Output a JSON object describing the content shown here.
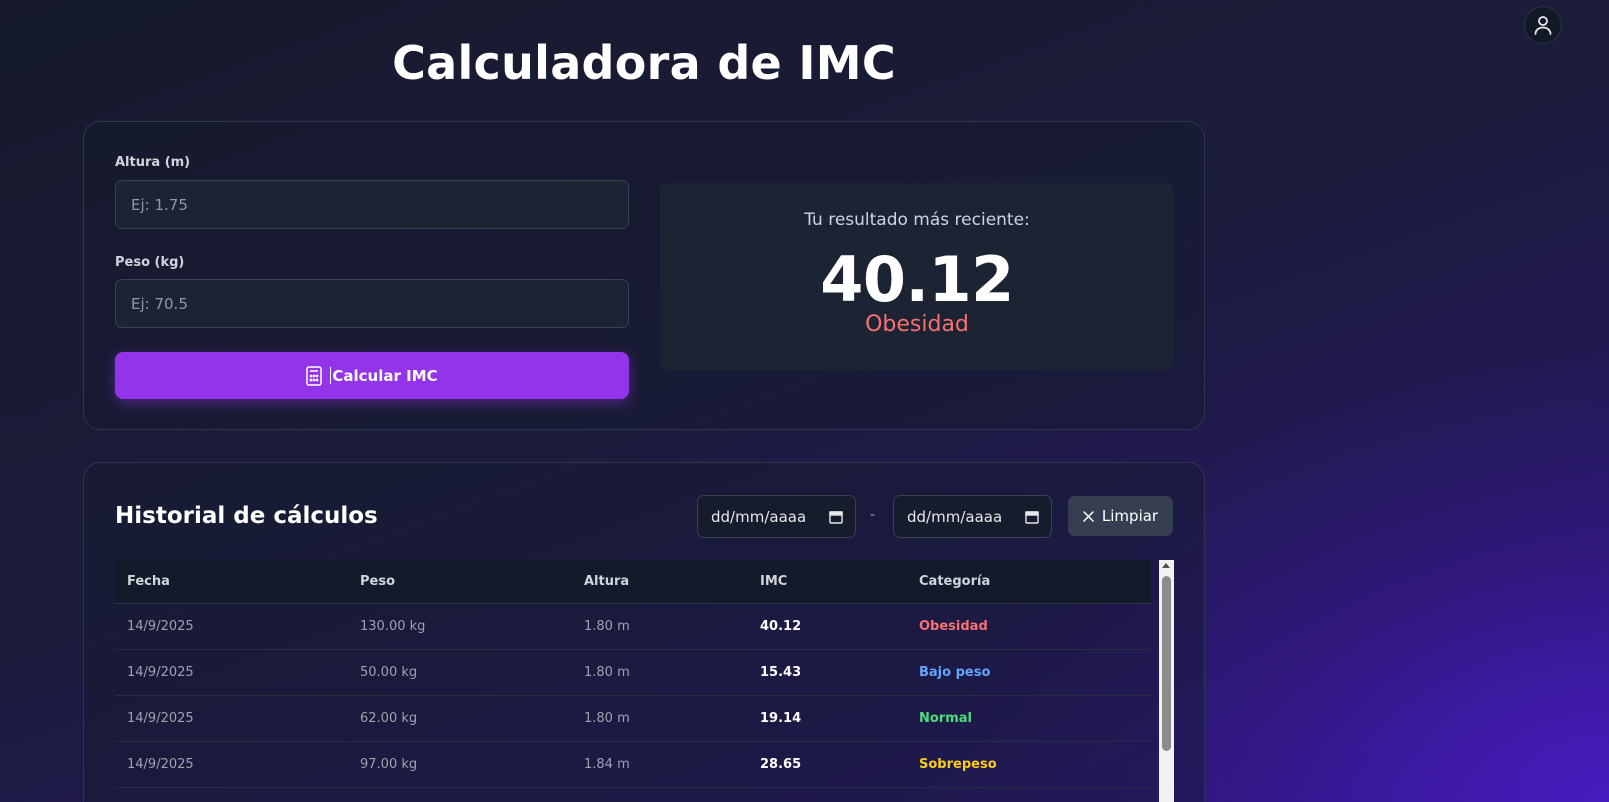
{
  "header": {
    "title": "Calculadora de IMC"
  },
  "form": {
    "height_label": "Altura (m)",
    "height_placeholder": "Ej: 1.75",
    "weight_label": "Peso (kg)",
    "weight_placeholder": "Ej: 70.5",
    "calculate_button": "Calcular IMC",
    "calculate_icon": "calculator-icon"
  },
  "result": {
    "caption": "Tu resultado más reciente:",
    "value": "40.12",
    "category": "Obesidad",
    "category_color": "#f87171"
  },
  "history": {
    "title": "Historial de cálculos",
    "date_from_placeholder": "dd/mm/aaaa",
    "date_to_placeholder": "dd/mm/aaaa",
    "date_separator": "-",
    "clear_button": "Limpiar",
    "columns": [
      "Fecha",
      "Peso",
      "Altura",
      "IMC",
      "Categoría"
    ],
    "rows": [
      {
        "date": "14/9/2025",
        "weight": "130.00 kg",
        "height": "1.80 m",
        "imc": "40.12",
        "category": "Obesidad",
        "category_color": "#f87171"
      },
      {
        "date": "14/9/2025",
        "weight": "50.00 kg",
        "height": "1.80 m",
        "imc": "15.43",
        "category": "Bajo peso",
        "category_color": "#60a5fa"
      },
      {
        "date": "14/9/2025",
        "weight": "62.00 kg",
        "height": "1.80 m",
        "imc": "19.14",
        "category": "Normal",
        "category_color": "#4ade80"
      },
      {
        "date": "14/9/2025",
        "weight": "97.00 kg",
        "height": "1.84 m",
        "imc": "28.65",
        "category": "Sobrepeso",
        "category_color": "#facc15"
      }
    ]
  },
  "colors": {
    "accent": "#9333ea",
    "panel": "#1c2333"
  },
  "icons": {
    "user": "user-icon",
    "calendar": "calendar-icon",
    "close": "close-icon"
  }
}
